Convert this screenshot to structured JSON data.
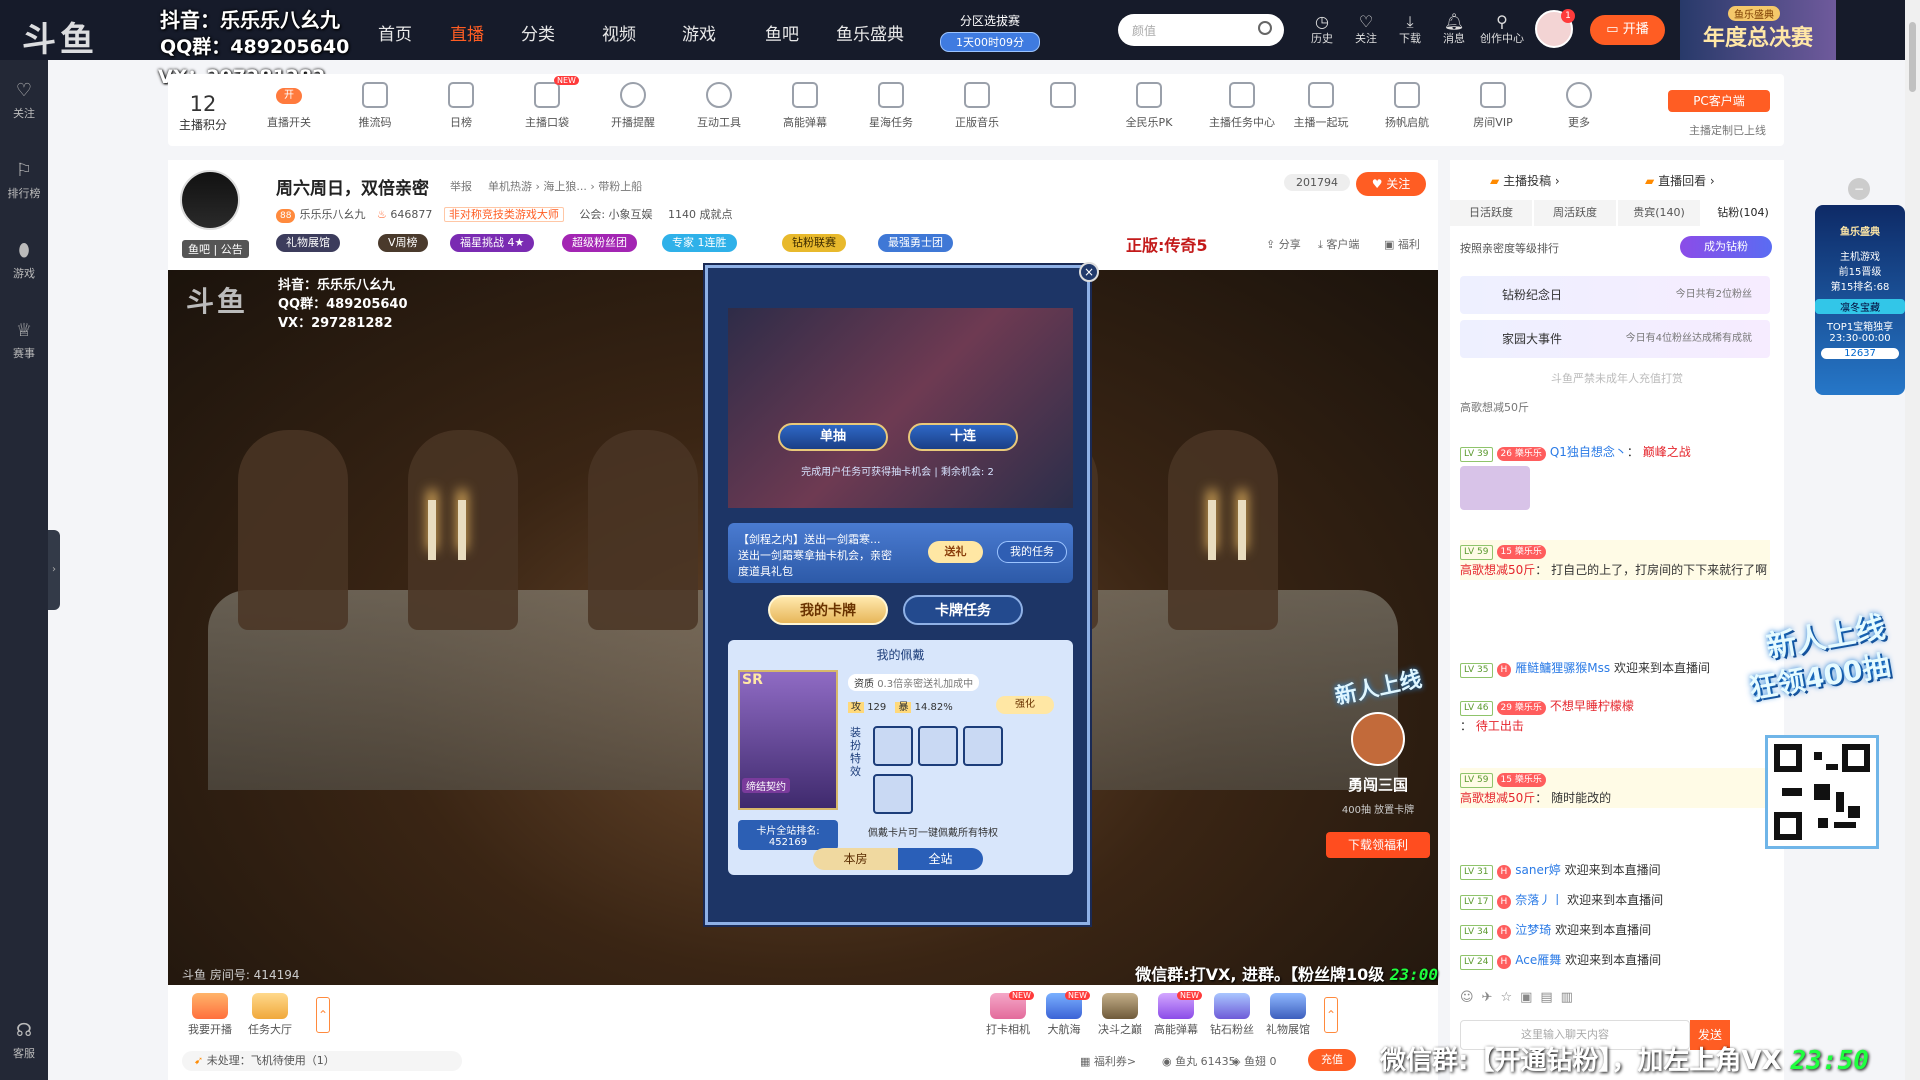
{
  "watermark": {
    "line1": "抖音：乐乐乐八幺九",
    "line2": "QQ群：489205640",
    "line3": "VX：297281282"
  },
  "header": {
    "logo": "斗鱼",
    "nav": [
      "首页",
      "直播",
      "分类",
      "视频",
      "游戏",
      "鱼吧",
      "鱼乐盛典"
    ],
    "zone_title": "分区选拔赛",
    "zone_countdown": "1天00时09分",
    "search_placeholder": "颜值",
    "icons": [
      {
        "label": "历史",
        "icon": "clock-icon"
      },
      {
        "label": "关注",
        "icon": "heart-icon"
      },
      {
        "label": "下载",
        "icon": "download-icon"
      },
      {
        "label": "消息",
        "icon": "bell-icon"
      },
      {
        "label": "创作中心",
        "icon": "bulb-icon"
      }
    ],
    "avatar_badge": "1",
    "start_live": "开播",
    "year_ad_small": "鱼乐盛典",
    "year_ad": "年度总决赛"
  },
  "leftnav": {
    "items": [
      "关注",
      "排行榜",
      "游戏",
      "赛事"
    ],
    "service": "客服"
  },
  "toolbar": {
    "score_value": "12",
    "score_label": "主播积分",
    "tools": [
      {
        "label": "直播开关",
        "badge": "开"
      },
      {
        "label": "推流码"
      },
      {
        "label": "日榜"
      },
      {
        "label": "主播口袋",
        "new": "NEW"
      },
      {
        "label": "开播提醒"
      },
      {
        "label": "互动工具"
      },
      {
        "label": "高能弹幕"
      },
      {
        "label": "星海任务"
      },
      {
        "label": "正版音乐"
      },
      {
        "label": ""
      },
      {
        "label": "全民乐PK"
      },
      {
        "label": "主播任务中心"
      },
      {
        "label": "主播一起玩"
      },
      {
        "label": "扬帆启航"
      },
      {
        "label": "房间VIP"
      },
      {
        "label": "更多"
      }
    ],
    "pc_client": "PC客户端",
    "pc_client_sub": "主播定制已上线"
  },
  "room": {
    "title": "周六周日，双倍亲密",
    "report": "举报",
    "category": "单机热游 › 海上狼... › 带粉上船",
    "level_badge": "88",
    "anchor": "乐乐乐八幺九",
    "heat": "646877",
    "tag": "非对称竞技类游戏大师",
    "guild": "公会: 小象互娱",
    "achievements": "1140 成就点",
    "fish_bar": "鱼吧",
    "notice": "公告",
    "medals": [
      "礼物展馆",
      "V周榜",
      "福星挑战 4★",
      "超级粉丝团",
      "专家  1连胜",
      "钻粉联赛",
      "最强勇士团"
    ],
    "fans_count": "201794",
    "follow": "关注",
    "ad_line": "正版:传奇5",
    "links": [
      "分享",
      "客户端",
      "福利"
    ]
  },
  "video": {
    "room_id": "斗鱼 房间号: 414194",
    "ticker": "微信群:打VX, 进群。【粉丝牌10级",
    "ticker_time": "23:00"
  },
  "modal": {
    "single": "单抽",
    "ten": "十连",
    "tip": "完成用户任务可获得抽卡机会 | 剩余机会: 2",
    "task_text1": "【剑程之内】送出一剑霜寒...",
    "task_text2": "送出一剑霜寒拿抽卡机会，亲密",
    "task_text3": "度道具礼包",
    "send_gift": "送礼",
    "my_tasks": "我的任务",
    "tab_cards": "我的卡牌",
    "tab_tasks": "卡牌任务",
    "wear_title": "我的佩戴",
    "rarity": "SR",
    "attr_label": "资质",
    "attr_value": "0.3倍亲密送礼加成中",
    "atk_label": "攻",
    "atk_value": "129",
    "crit_label": "暴",
    "crit_value": "14.82%",
    "enhance": "强化",
    "effect_label": "装扮特效",
    "contract": "缔结契约",
    "rank_label": "卡片全站排名:",
    "rank_value": "452169",
    "wear_desc": "佩戴卡片可一键佩戴所有特权",
    "tab_room": "本房",
    "tab_site": "全站"
  },
  "sidebar": {
    "vote": "主播投稿",
    "replay": "直播回看",
    "tabs": [
      "日活跃度",
      "周活跃度",
      "贵宾(140)",
      "钻粉(104)"
    ],
    "rank_note": "按照亲密度等级排行",
    "become_fan": "成为钻粉",
    "events": [
      {
        "title": "钻粉纪念日",
        "right": "今日共有2位粉丝"
      },
      {
        "title": "家园大事件",
        "right": "今日有4位粉丝达成稀有成就"
      }
    ],
    "minor_notice": "斗鱼严禁未成年人充值打赏",
    "first_row": "高歌想减50斤",
    "chats": [
      {
        "lv": "LV 39",
        "badge": "26 樂乐乐",
        "user": "Q1独自想念丶",
        "msg": "巅峰之战",
        "msg_color": "red"
      },
      {
        "lv": "LV 59",
        "badge": "15 樂乐乐",
        "user": "高歌想减50斤",
        "msg": "打自己的上了，打房间的下下来就行了啊",
        "msg_color": "red"
      },
      {
        "lv": "LV 35",
        "badge": "H",
        "user": "雁鲢鳙狸骡猴Mss",
        "msg": "欢迎来到本直播间",
        "msg_color": "normal"
      },
      {
        "lv": "LV 46",
        "badge": "29 樂乐乐",
        "user": "不想早睡柠檬檬",
        "msg": "待工出击",
        "msg_color": "red"
      },
      {
        "lv": "LV 59",
        "badge": "15 樂乐乐",
        "user": "高歌想减50斤",
        "msg": "随时能改的",
        "msg_color": "red"
      },
      {
        "lv": "LV 31",
        "badge": "H",
        "user": "saner婷",
        "msg": "欢迎来到本直播间",
        "msg_color": "normal"
      },
      {
        "lv": "LV 17",
        "badge": "H",
        "user": "奈落丿丨",
        "msg": "欢迎来到本直播间",
        "msg_color": "normal"
      },
      {
        "lv": "LV 34",
        "badge": "H",
        "user": "泣梦琦",
        "msg": "欢迎来到本直播间",
        "msg_color": "normal"
      },
      {
        "lv": "LV 24",
        "badge": "H",
        "user": "Ace雁舞",
        "msg": "欢迎来到本直播间",
        "msg_color": "normal"
      }
    ],
    "chat_placeholder": "这里输入聊天内容",
    "send": "发送"
  },
  "side_ad": {
    "title": "鱼乐盛典",
    "l1": "主机游戏",
    "l2": "前15晋级",
    "l3": "第15排名:68",
    "l4": "凛冬宝藏",
    "l5": "TOP1宝箱独享",
    "l6": "23:30-00:00",
    "l7": "12637"
  },
  "sticker": {
    "l1": "新人上线",
    "l2": "狂领400抽"
  },
  "game_ad": {
    "name": "勇闯三国",
    "l1": "400抽",
    "l2": "放置卡牌",
    "btn": "下载领福利"
  },
  "bottombar": {
    "left": [
      "我要开播",
      "任务大厅"
    ],
    "gifts": [
      {
        "label": "打卡相机",
        "new": "NEW"
      },
      {
        "label": "大航海",
        "new": "NEW"
      },
      {
        "label": "决斗之巅",
        "new": ""
      },
      {
        "label": "高能弹幕",
        "new": "NEW"
      },
      {
        "label": "钻石粉丝",
        "new": ""
      },
      {
        "label": "礼物展馆",
        "new": ""
      }
    ],
    "pending": "未处理：飞机待使用（1）",
    "welfare": "福利券>",
    "fish_balls": "鱼丸 61435",
    "fish_fins": "鱼翅 0",
    "recharge": "充值"
  },
  "bottom_ticker": {
    "text": "微信群:【开通钻粉】，加左上角VX",
    "time": "23:50"
  }
}
